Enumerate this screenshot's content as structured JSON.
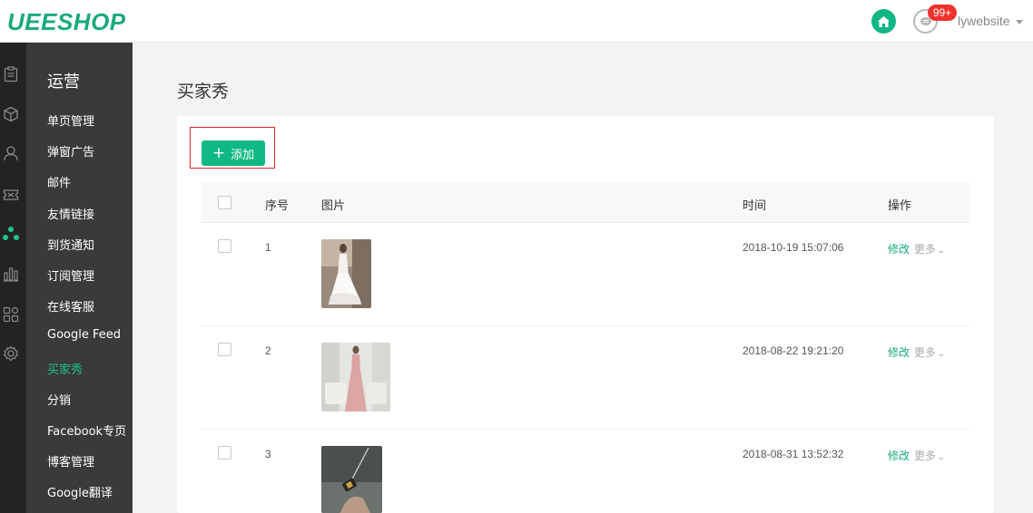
{
  "header": {
    "logo": "UEESHOP",
    "badge_count": "99+",
    "username": "lywebsite"
  },
  "rail": {
    "icons": [
      "orders-icon",
      "products-icon",
      "customers-icon",
      "coupon-icon",
      "operations-icon",
      "stats-icon",
      "apps-icon",
      "settings-icon"
    ]
  },
  "sidebar": {
    "title": "运营",
    "items": [
      {
        "label": "单页管理"
      },
      {
        "label": "弹窗广告"
      },
      {
        "label": "邮件"
      },
      {
        "label": "友情链接"
      },
      {
        "label": "到货通知"
      },
      {
        "label": "订阅管理"
      },
      {
        "label": "在线客服"
      },
      {
        "label": "Google Feed"
      },
      {
        "label": "买家秀"
      },
      {
        "label": "分销"
      },
      {
        "label": "Facebook专页"
      },
      {
        "label": "博客管理"
      },
      {
        "label": "Google翻译"
      }
    ],
    "active_index": 8
  },
  "main": {
    "title": "买家秀",
    "add_button": "添加",
    "table": {
      "headers": {
        "index": "序号",
        "image": "图片",
        "time": "时间",
        "actions": "操作"
      },
      "rows": [
        {
          "index": "1",
          "time": "2018-10-19 15:07:06",
          "edit": "修改",
          "more": "更多"
        },
        {
          "index": "2",
          "time": "2018-08-22 19:21:20",
          "edit": "修改",
          "more": "更多"
        },
        {
          "index": "3",
          "time": "2018-08-31 13:52:32",
          "edit": "修改",
          "more": "更多"
        }
      ]
    }
  },
  "colors": {
    "brand": "#1aaa7a",
    "accent": "#10b983",
    "badge": "#f0322b",
    "active_nav": "#1fc38e"
  }
}
